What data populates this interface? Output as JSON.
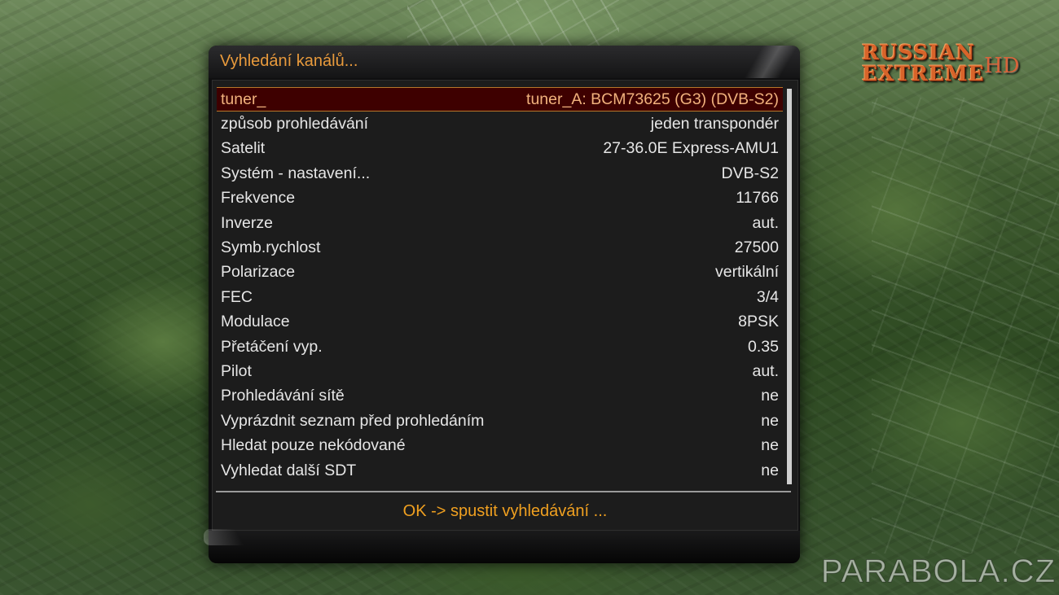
{
  "dialog": {
    "title": "Vyhledání kanálů...",
    "rows": [
      {
        "label": "tuner_",
        "value": "tuner_A: BCM73625 (G3) (DVB-S2)",
        "selected": true
      },
      {
        "label": "způsob prohledávání",
        "value": "jeden transpondér"
      },
      {
        "label": "Satelit",
        "value": "27-36.0E Express-AMU1"
      },
      {
        "label": "Systém - nastavení...",
        "value": "DVB-S2"
      },
      {
        "label": "Frekvence",
        "value": "11766"
      },
      {
        "label": "Inverze",
        "value": "aut."
      },
      {
        "label": "Symb.rychlost",
        "value": "27500"
      },
      {
        "label": "Polarizace",
        "value": "vertikální"
      },
      {
        "label": "FEC",
        "value": "3/4"
      },
      {
        "label": "Modulace",
        "value": "8PSK"
      },
      {
        "label": "Přetáčení vyp.",
        "value": "0.35"
      },
      {
        "label": "Pilot",
        "value": "aut."
      },
      {
        "label": "Prohledávání sítě",
        "value": "ne"
      },
      {
        "label": "Vyprázdnit seznam před prohledáním",
        "value": "ne"
      },
      {
        "label": "Hledat pouze nekódované",
        "value": "ne"
      },
      {
        "label": "Vyhledat další SDT",
        "value": "ne"
      }
    ],
    "status": "OK -> spustit vyhledávání ..."
  },
  "logo": {
    "line1": "RUSSIAN",
    "line2": "EXTREME",
    "suffix": "HD"
  },
  "watermark": "PARABOLA.CZ",
  "colors": {
    "accent": "#e89a3c",
    "status": "#f0a020",
    "selection_bg": "#3e0000",
    "selection_border": "#b7772a"
  }
}
